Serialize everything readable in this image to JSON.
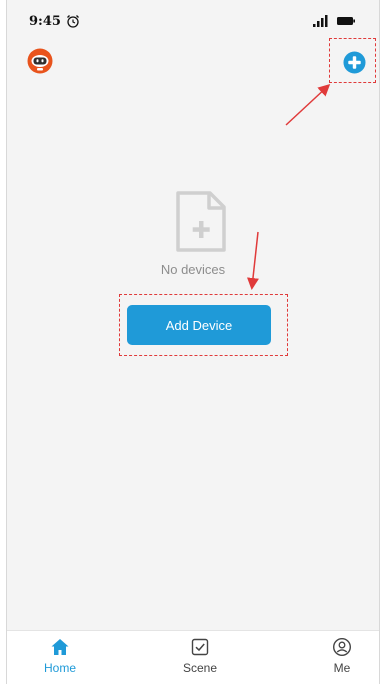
{
  "status_bar": {
    "time": "9:45",
    "alarm_icon": "alarm-clock-icon",
    "signal_icon": "signal-bars-icon",
    "battery_icon": "battery-icon"
  },
  "header": {
    "avatar_icon": "robot-avatar-icon",
    "add_icon": "plus-circle-icon"
  },
  "empty_state": {
    "icon": "document-add-icon",
    "message": "No devices",
    "button_label": "Add Device"
  },
  "tabs": [
    {
      "label": "Home",
      "icon": "home-icon",
      "active": true
    },
    {
      "label": "Scene",
      "icon": "checkbox-icon",
      "active": false
    },
    {
      "label": "Me",
      "icon": "user-circle-icon",
      "active": false
    }
  ],
  "colors": {
    "accent": "#1f9ad8",
    "annotation": "#e03a3a",
    "background": "#f4f4f4"
  }
}
